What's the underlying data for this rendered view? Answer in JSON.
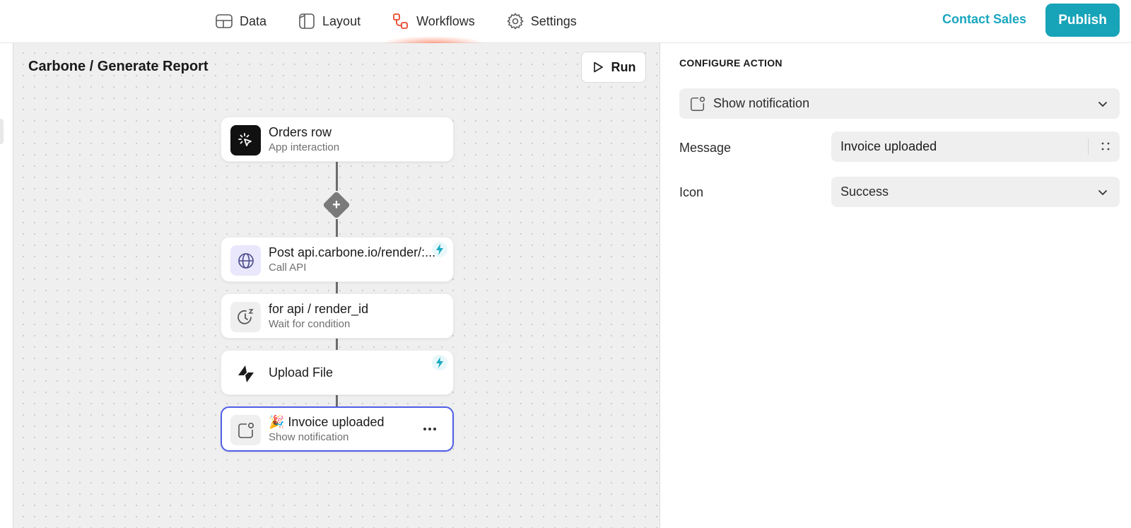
{
  "nav": {
    "items": [
      {
        "label": "Data",
        "icon": "table-icon"
      },
      {
        "label": "Layout",
        "icon": "layout-icon"
      },
      {
        "label": "Workflows",
        "icon": "workflow-icon",
        "active": true
      },
      {
        "label": "Settings",
        "icon": "gear-icon"
      }
    ],
    "contact_label": "Contact Sales",
    "publish_label": "Publish"
  },
  "canvas": {
    "title": "Carbone / Generate Report",
    "run_label": "Run",
    "nodes": [
      {
        "title": "Orders row",
        "subtitle": "App interaction",
        "icon": "cursor-click-icon"
      },
      {
        "title": "Post api.carbone.io/render/:...",
        "subtitle": "Call API",
        "icon": "globe-icon",
        "bolt": true
      },
      {
        "title": "for api / render_id",
        "subtitle": "Wait for condition",
        "icon": "clock-wait-icon"
      },
      {
        "title": "Upload File",
        "subtitle": "",
        "icon": "lightning-logo-icon",
        "bolt": true
      },
      {
        "title": "🎉 Invoice uploaded",
        "subtitle": "Show notification",
        "icon": "notification-icon",
        "selected": true
      }
    ]
  },
  "panel": {
    "title": "CONFIGURE ACTION",
    "action_type": "Show notification",
    "message_label": "Message",
    "message_value": "Invoice uploaded",
    "icon_label": "Icon",
    "icon_value": "Success"
  },
  "colors": {
    "accent": "#17a3b8",
    "selected_border": "#4f5ee8",
    "active_nav_icon": "#e8472b"
  }
}
